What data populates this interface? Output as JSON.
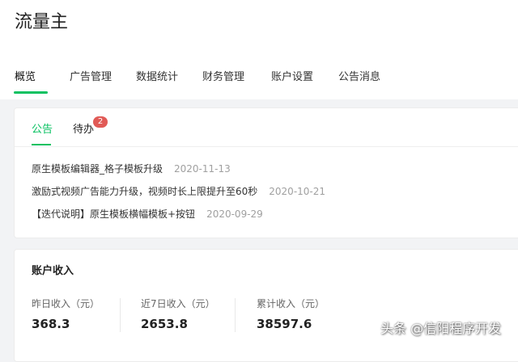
{
  "app": {
    "title": "流量主"
  },
  "nav": {
    "items": [
      {
        "label": "概览",
        "active": true
      },
      {
        "label": "广告管理"
      },
      {
        "label": "数据统计"
      },
      {
        "label": "财务管理"
      },
      {
        "label": "账户设置"
      },
      {
        "label": "公告消息"
      }
    ]
  },
  "notice": {
    "tabs": [
      {
        "label": "公告",
        "active": true
      },
      {
        "label": "待办",
        "badge": "2"
      }
    ],
    "items": [
      {
        "title": "原生模板编辑器_格子模板升级",
        "date": "2020-11-13"
      },
      {
        "title": "激励式视频广告能力升级，视频时长上限提升至60秒",
        "date": "2020-10-21"
      },
      {
        "title": "【迭代说明】原生模板横幅模板+按钮",
        "date": "2020-09-29"
      }
    ]
  },
  "income": {
    "title": "账户收入",
    "stats": [
      {
        "label": "昨日收入（元）",
        "value": "368.3"
      },
      {
        "label": "近7日收入（元）",
        "value": "2653.8"
      },
      {
        "label": "累计收入（元）",
        "value": "38597.6"
      }
    ]
  },
  "colors": {
    "accent": "#07c160",
    "badge": "#e15a56"
  },
  "watermark": {
    "text": "头条 @信阳程序开发"
  }
}
